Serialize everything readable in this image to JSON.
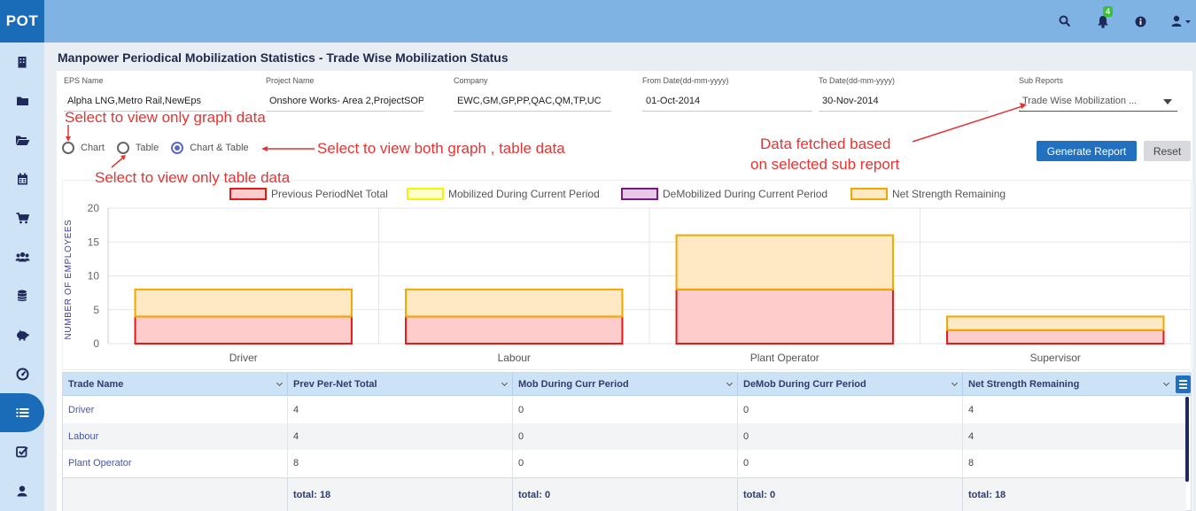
{
  "app": {
    "logo": "POT"
  },
  "topbar": {
    "notification_count": "4"
  },
  "page": {
    "title": "Manpower Periodical Mobilization Statistics - Trade Wise Mobilization Status"
  },
  "filters": {
    "eps_label": "EPS Name",
    "eps_value": "Alpha LNG,Metro Rail,NewEps",
    "project_label": "Project Name",
    "project_value": "Onshore  Works- Area 2,ProjectSOP",
    "company_label": "Company",
    "company_value": "EWC,GM,GP,PP,QAC,QM,TP,UC",
    "from_label": "From Date(dd-mm-yyyy)",
    "from_value": "01-Oct-2014",
    "to_label": "To Date(dd-mm-yyyy)",
    "to_value": "30-Nov-2014",
    "sub_label": "Sub Reports",
    "sub_value": "Trade Wise Mobilization ..."
  },
  "view_options": {
    "chart": "Chart",
    "table": "Table",
    "chart_table": "Chart & Table",
    "selected": "chart_table"
  },
  "buttons": {
    "generate": "Generate Report",
    "reset": "Reset"
  },
  "annotations": {
    "graph_only": "Select to view only graph data",
    "table_only": "Select to view only table data",
    "both": "Select to view both graph , table data",
    "subreport_line1": "Data fetched based",
    "subreport_line2": "on selected sub report"
  },
  "chart_data": {
    "type": "bar",
    "stacked": true,
    "categories": [
      "Driver",
      "Labour",
      "Plant Operator",
      "Supervisor"
    ],
    "series": [
      {
        "name": "Previous PeriodNet Total",
        "values": [
          4,
          4,
          8,
          2
        ],
        "fill": "#ffcccc",
        "stroke": "#e31a1a"
      },
      {
        "name": "Mobilized During Current Period",
        "values": [
          0,
          0,
          0,
          0
        ],
        "fill": "#ffffcc",
        "stroke": "#f5f500"
      },
      {
        "name": "DeMobilized During Current Period",
        "values": [
          0,
          0,
          0,
          0
        ],
        "fill": "#e8c8e8",
        "stroke": "#7a1a7a"
      },
      {
        "name": "Net Strength Remaining",
        "values": [
          4,
          4,
          8,
          2
        ],
        "fill": "#ffe8c4",
        "stroke": "#f0a800"
      }
    ],
    "ylabel": "NUMBER OF EMPLOYEES",
    "ylim": [
      0,
      20
    ],
    "yticks": [
      0,
      5,
      10,
      15,
      20
    ],
    "grid": true,
    "legend": "top"
  },
  "table": {
    "columns": [
      "Trade Name",
      "Prev Per-Net Total",
      "Mob During Curr Period",
      "DeMob During Curr Period",
      "Net Strength Remaining"
    ],
    "rows": [
      [
        "Driver",
        "4",
        "0",
        "0",
        "4"
      ],
      [
        "Labour",
        "4",
        "0",
        "0",
        "4"
      ],
      [
        "Plant Operator",
        "8",
        "0",
        "0",
        "8"
      ]
    ],
    "totals": [
      "",
      "total: 18",
      "total: 0",
      "total: 0",
      "total: 18"
    ]
  }
}
